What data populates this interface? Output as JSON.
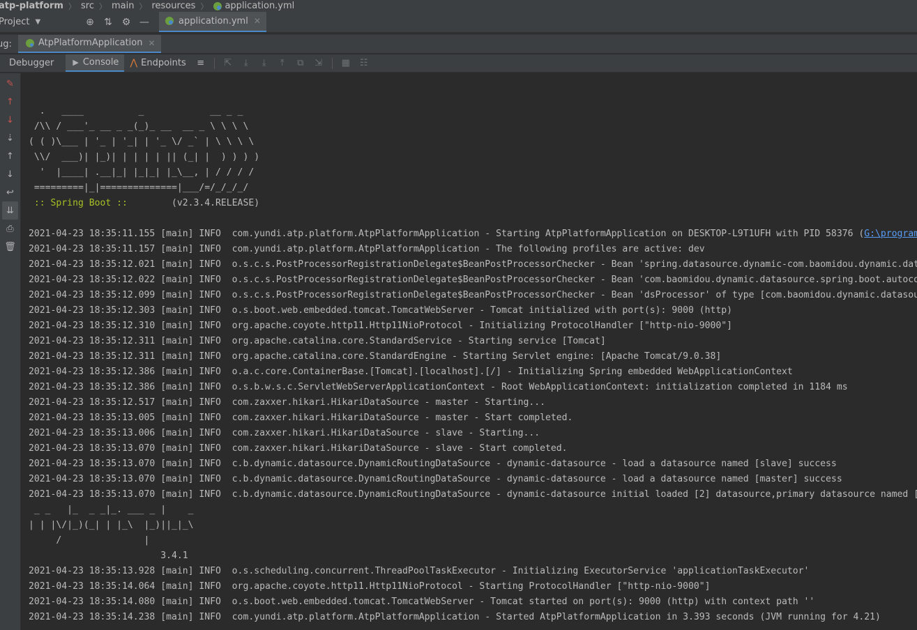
{
  "breadcrumb": [
    "atp-platform",
    "src",
    "main",
    "resources",
    "application.yml"
  ],
  "project_label": "Project",
  "file_tab": "application.yml",
  "debug_label": "ug:",
  "run_tab": "AtpPlatformApplication",
  "debug_tabs": [
    "Debugger",
    "Console",
    "Endpoints"
  ],
  "banner": [
    "  .   ____          _            __ _ _",
    " /\\\\ / ___'_ __ _ _(_)_ __  __ _ \\ \\ \\ \\",
    "( ( )\\___ | '_ | '_| | '_ \\/ _` | \\ \\ \\ \\",
    " \\\\/  ___)| |_)| | | | | || (_| |  ) ) ) )",
    "  '  |____| .__|_| |_|_| |_\\__, | / / / /",
    " =========|_|==============|___/=/_/_/_/"
  ],
  "spring_label": " :: Spring Boot :: ",
  "spring_version": "       (v2.3.4.RELEASE)",
  "log_a": [
    {
      "prefix": "2021-04-23 18:35:11.155 [main] INFO  com.yundi.atp.platform.AtpPlatformApplication - Starting AtpPlatformApplication on DESKTOP-L9T1UFH with PID 58376 (",
      "link": "G:\\program"
    },
    {
      "prefix": "2021-04-23 18:35:11.157 [main] INFO  com.yundi.atp.platform.AtpPlatformApplication - The following profiles are active: dev",
      "link": ""
    },
    {
      "prefix": "2021-04-23 18:35:12.021 [main] INFO  o.s.c.s.PostProcessorRegistrationDelegate$BeanPostProcessorChecker - Bean 'spring.datasource.dynamic-com.baomidou.dynamic.datasource",
      "link": ""
    },
    {
      "prefix": "2021-04-23 18:35:12.022 [main] INFO  o.s.c.s.PostProcessorRegistrationDelegate$BeanPostProcessorChecker - Bean 'com.baomidou.dynamic.datasource.spring.boot.autoconfigure",
      "link": ""
    },
    {
      "prefix": "2021-04-23 18:35:12.099 [main] INFO  o.s.c.s.PostProcessorRegistrationDelegate$BeanPostProcessorChecker - Bean 'dsProcessor' of type [com.baomidou.dynamic.datasource",
      "link": ""
    },
    {
      "prefix": "2021-04-23 18:35:12.303 [main] INFO  o.s.boot.web.embedded.tomcat.TomcatWebServer - Tomcat initialized with port(s): 9000 (http)",
      "link": ""
    },
    {
      "prefix": "2021-04-23 18:35:12.310 [main] INFO  org.apache.coyote.http11.Http11NioProtocol - Initializing ProtocolHandler [\"http-nio-9000\"]",
      "link": ""
    },
    {
      "prefix": "2021-04-23 18:35:12.311 [main] INFO  org.apache.catalina.core.StandardService - Starting service [Tomcat]",
      "link": ""
    },
    {
      "prefix": "2021-04-23 18:35:12.311 [main] INFO  org.apache.catalina.core.StandardEngine - Starting Servlet engine: [Apache Tomcat/9.0.38]",
      "link": ""
    },
    {
      "prefix": "2021-04-23 18:35:12.386 [main] INFO  o.a.c.core.ContainerBase.[Tomcat].[localhost].[/] - Initializing Spring embedded WebApplicationContext",
      "link": ""
    },
    {
      "prefix": "2021-04-23 18:35:12.386 [main] INFO  o.s.b.w.s.c.ServletWebServerApplicationContext - Root WebApplicationContext: initialization completed in 1184 ms",
      "link": ""
    },
    {
      "prefix": "2021-04-23 18:35:12.517 [main] INFO  com.zaxxer.hikari.HikariDataSource - master - Starting...",
      "link": ""
    },
    {
      "prefix": "2021-04-23 18:35:13.005 [main] INFO  com.zaxxer.hikari.HikariDataSource - master - Start completed.",
      "link": ""
    },
    {
      "prefix": "2021-04-23 18:35:13.006 [main] INFO  com.zaxxer.hikari.HikariDataSource - slave - Starting...",
      "link": ""
    },
    {
      "prefix": "2021-04-23 18:35:13.070 [main] INFO  com.zaxxer.hikari.HikariDataSource - slave - Start completed.",
      "link": ""
    },
    {
      "prefix": "2021-04-23 18:35:13.070 [main] INFO  c.b.dynamic.datasource.DynamicRoutingDataSource - dynamic-datasource - load a datasource named [slave] success",
      "link": ""
    },
    {
      "prefix": "2021-04-23 18:35:13.070 [main] INFO  c.b.dynamic.datasource.DynamicRoutingDataSource - dynamic-datasource - load a datasource named [master] success",
      "link": ""
    },
    {
      "prefix": "2021-04-23 18:35:13.070 [main] INFO  c.b.dynamic.datasource.DynamicRoutingDataSource - dynamic-datasource initial loaded [2] datasource,primary datasource named [master]",
      "link": ""
    }
  ],
  "mp_banner": [
    " _ _   |_  _ _|_. ___ _ |    _",
    "| | |\\/|_)(_| | |_\\  |_)||_|_\\",
    "     /               |",
    "                        3.4.1"
  ],
  "log_b": [
    "2021-04-23 18:35:13.928 [main] INFO  o.s.scheduling.concurrent.ThreadPoolTaskExecutor - Initializing ExecutorService 'applicationTaskExecutor'",
    "2021-04-23 18:35:14.064 [main] INFO  org.apache.coyote.http11.Http11NioProtocol - Starting ProtocolHandler [\"http-nio-9000\"]",
    "2021-04-23 18:35:14.080 [main] INFO  o.s.boot.web.embedded.tomcat.TomcatWebServer - Tomcat started on port(s): 9000 (http) with context path ''",
    "2021-04-23 18:35:14.238 [main] INFO  com.yundi.atp.platform.AtpPlatformApplication - Started AtpPlatformApplication in 3.393 seconds (JVM running for 4.21)"
  ],
  "colors": {
    "accent": "#4a88c7",
    "spring_green": "#a8c023",
    "link": "#589df6",
    "error_red": "#c75450"
  }
}
